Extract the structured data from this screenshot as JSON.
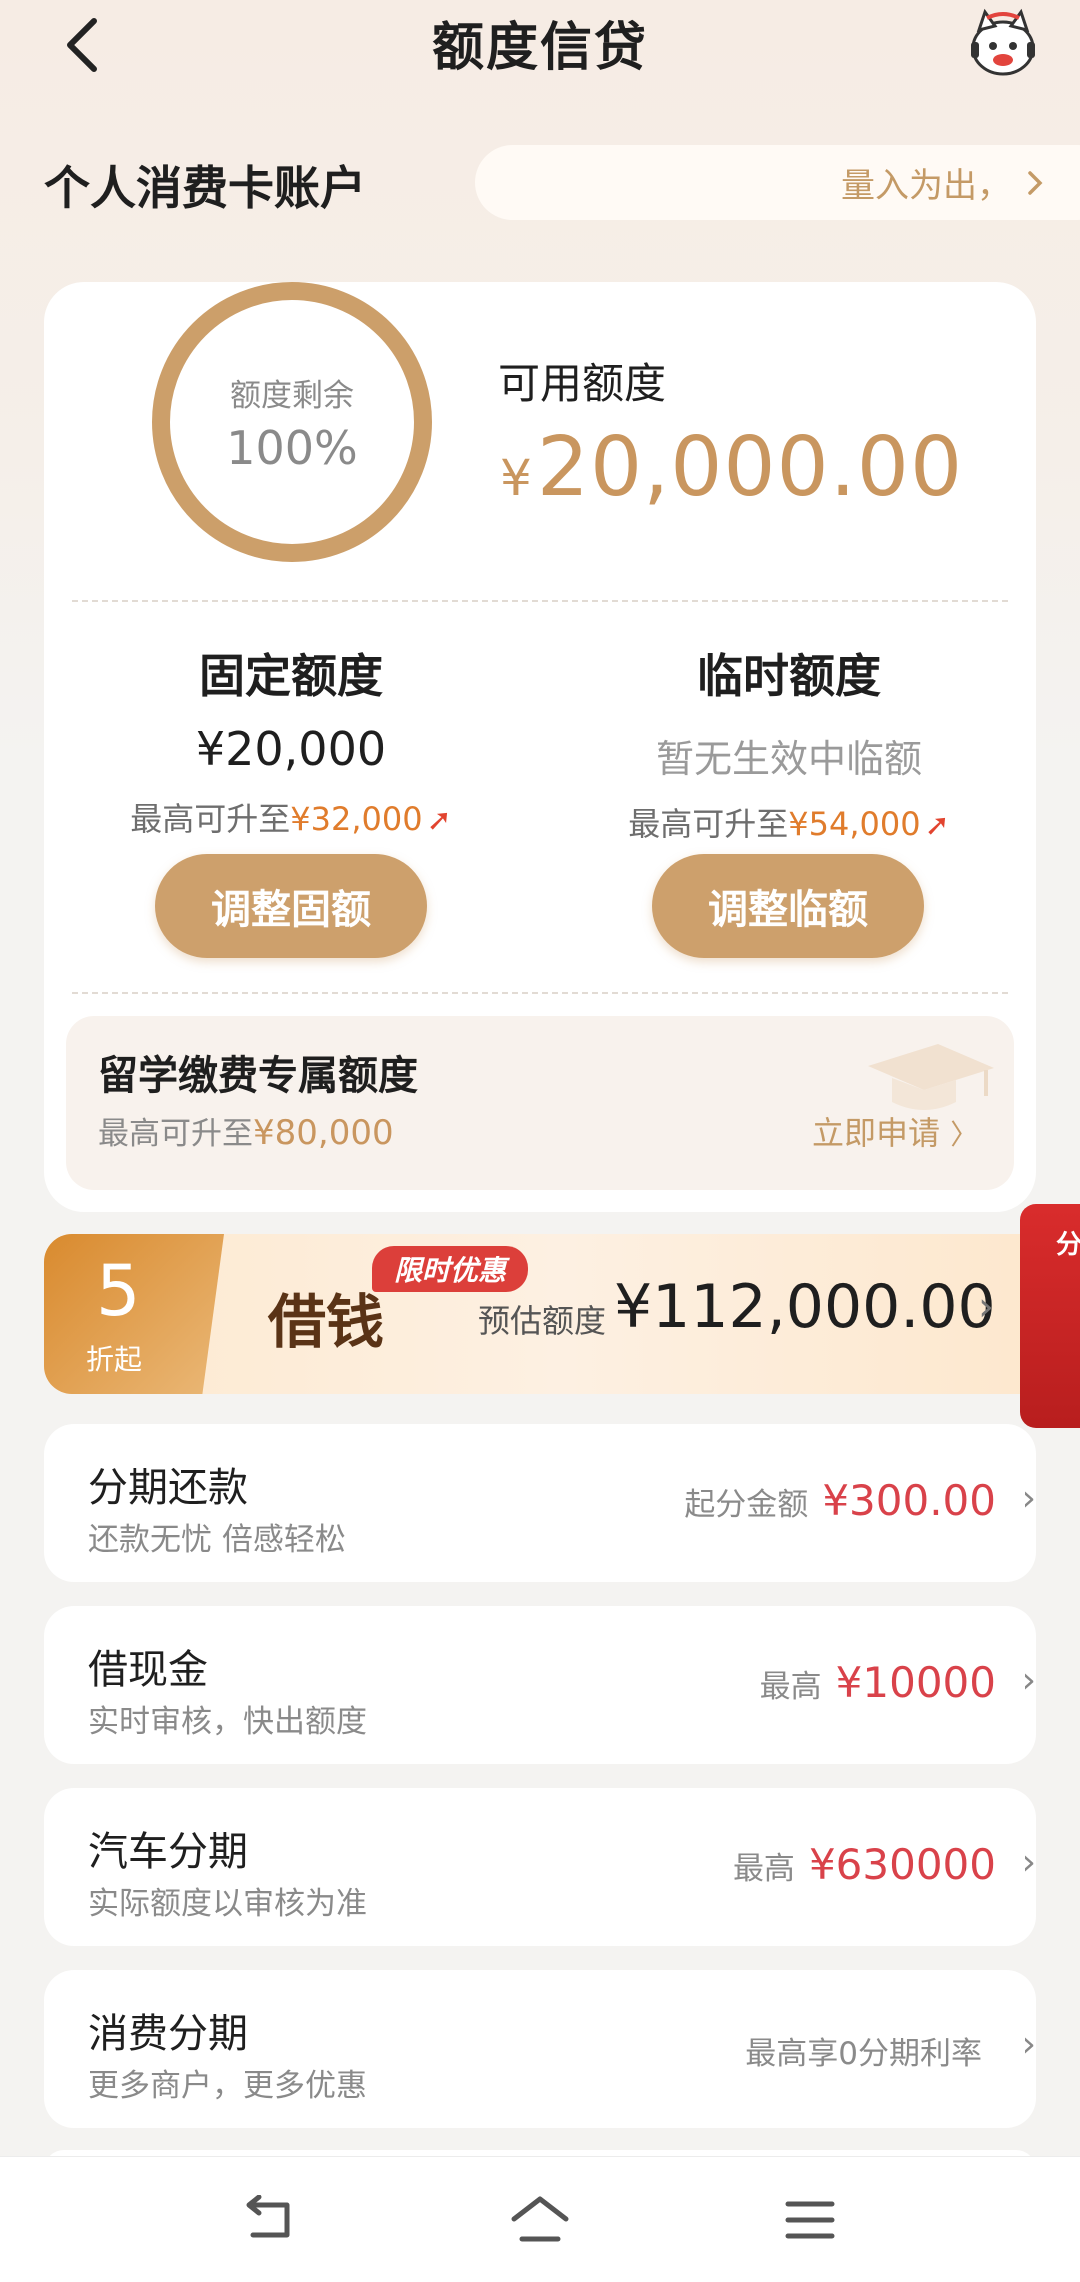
{
  "header": {
    "title": "额度信贷",
    "back_icon": "chevron-left-icon",
    "assistant_icon": "mascot-avatar-icon"
  },
  "account": {
    "title": "个人消费卡账户",
    "slogan": "量入为出，"
  },
  "credit": {
    "ring_label": "额度剩余",
    "ring_value": "100%",
    "ring_fraction": 1.0,
    "available_label": "可用额度",
    "available_currency": "¥",
    "available_amount": "20,000.00"
  },
  "fixed": {
    "title": "固定额度",
    "amount": "¥20,000",
    "max_prefix": "最高可升至",
    "max_value": "¥32,000",
    "button": "调整固额"
  },
  "temporary": {
    "title": "临时额度",
    "status": "暂无生效中临额",
    "max_prefix": "最高可升至",
    "max_value": "¥54,000",
    "button": "调整临额"
  },
  "study": {
    "title": "留学缴费专属额度",
    "max_prefix": "最高可升至",
    "max_value": "¥80,000",
    "apply": "立即申请"
  },
  "loan": {
    "discount_number": "5",
    "discount_unit": "折起",
    "title": "借钱",
    "promo": "限时优惠",
    "estimate_label": "预估额度",
    "estimate_amount": "¥112,000.00"
  },
  "side_float": {
    "text": "分"
  },
  "list": [
    {
      "title": "分期还款",
      "sub": "还款无忧 倍感轻松",
      "label": "起分金额",
      "value": "¥300.00"
    },
    {
      "title": "借现金",
      "sub": "实时审核，快出额度",
      "label": "最高",
      "value": "¥10000"
    },
    {
      "title": "汽车分期",
      "sub": "实际额度以审核为准",
      "label": "最高",
      "value": "¥630000"
    },
    {
      "title": "消费分期",
      "sub": "更多商户，更多优惠",
      "label": "最高享0分期利率",
      "value": ""
    }
  ],
  "colors": {
    "accent_gold": "#cda06c",
    "amount_red": "#d9424a",
    "highlight_orange": "#e07c2c"
  }
}
